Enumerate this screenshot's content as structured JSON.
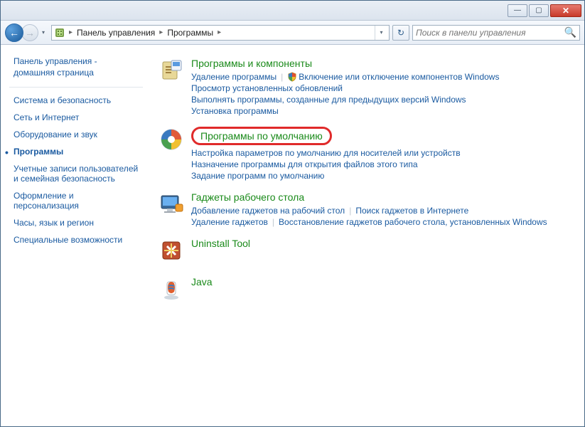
{
  "window": {
    "controls": {
      "min": "—",
      "max": "▢",
      "close": "✕"
    }
  },
  "nav": {
    "back_arrow": "←",
    "fwd_arrow": "→",
    "dropdown": "▾"
  },
  "breadcrumb": {
    "sep": "▸",
    "items": [
      "Панель управления",
      "Программы"
    ]
  },
  "search": {
    "placeholder": "Поиск в панели управления",
    "icon": "🔍"
  },
  "refresh": {
    "icon": "↻"
  },
  "sidebar": {
    "home": "Панель управления - домашняя страница",
    "items": [
      {
        "label": "Система и безопасность",
        "active": false
      },
      {
        "label": "Сеть и Интернет",
        "active": false
      },
      {
        "label": "Оборудование и звук",
        "active": false
      },
      {
        "label": "Программы",
        "active": true
      },
      {
        "label": "Учетные записи пользователей и семейная безопасность",
        "active": false
      },
      {
        "label": "Оформление и персонализация",
        "active": false
      },
      {
        "label": "Часы, язык и регион",
        "active": false
      },
      {
        "label": "Специальные возможности",
        "active": false
      }
    ]
  },
  "sections": [
    {
      "title": "Программы и компоненты",
      "highlighted": false,
      "links": [
        {
          "text": "Удаление программы",
          "shield": false,
          "newline_after": false
        },
        {
          "text": "Включение или отключение компонентов Windows",
          "shield": true,
          "newline_after": true
        },
        {
          "text": "Просмотр установленных обновлений",
          "shield": false,
          "newline_after": true
        },
        {
          "text": "Выполнять программы, созданные для предыдущих версий Windows",
          "shield": false,
          "newline_after": true
        },
        {
          "text": "Установка программы",
          "shield": false,
          "newline_after": false
        }
      ]
    },
    {
      "title": "Программы по умолчанию",
      "highlighted": true,
      "links": [
        {
          "text": "Настройка параметров по умолчанию для носителей или устройств",
          "shield": false,
          "newline_after": true
        },
        {
          "text": "Назначение программы для открытия файлов этого типа",
          "shield": false,
          "newline_after": true
        },
        {
          "text": "Задание программ по умолчанию",
          "shield": false,
          "newline_after": false
        }
      ]
    },
    {
      "title": "Гаджеты рабочего стола",
      "highlighted": false,
      "links": [
        {
          "text": "Добавление гаджетов на рабочий стол",
          "shield": false,
          "newline_after": false
        },
        {
          "text": "Поиск гаджетов в Интернете",
          "shield": false,
          "newline_after": true
        },
        {
          "text": "Удаление гаджетов",
          "shield": false,
          "newline_after": false
        },
        {
          "text": "Восстановление гаджетов рабочего стола, установленных Windows",
          "shield": false,
          "newline_after": false
        }
      ]
    },
    {
      "title": "Uninstall Tool",
      "highlighted": false,
      "links": []
    },
    {
      "title": "Java",
      "highlighted": false,
      "links": []
    }
  ]
}
